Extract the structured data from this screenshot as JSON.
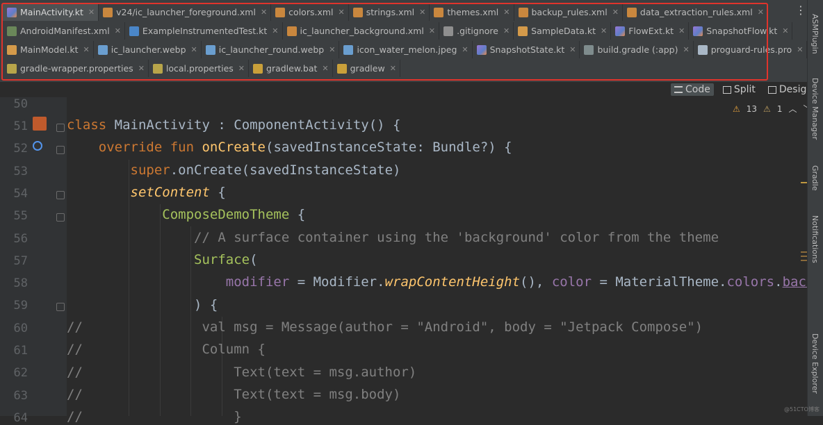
{
  "tabs": {
    "row1": [
      {
        "label": "MainActivity.kt",
        "icon": "kotlin-file-icon",
        "active": true
      },
      {
        "label": "v24/ic_launcher_foreground.xml",
        "icon": "xml-file-icon"
      },
      {
        "label": "colors.xml",
        "icon": "xml-file-icon"
      },
      {
        "label": "strings.xml",
        "icon": "xml-file-icon"
      },
      {
        "label": "themes.xml",
        "icon": "xml-file-icon"
      },
      {
        "label": "backup_rules.xml",
        "icon": "xml-file-icon"
      },
      {
        "label": "data_extraction_rules.xml",
        "icon": "xml-file-icon"
      }
    ],
    "row2": [
      {
        "label": "AndroidManifest.xml",
        "icon": "manifest-file-icon"
      },
      {
        "label": "ExampleInstrumentedTest.kt",
        "icon": "test-file-icon"
      },
      {
        "label": "ic_launcher_background.xml",
        "icon": "xml-file-icon"
      },
      {
        "label": ".gitignore",
        "icon": "gitignore-file-icon"
      },
      {
        "label": "SampleData.kt",
        "icon": "kotlin-class-icon"
      },
      {
        "label": "FlowExt.kt",
        "icon": "kotlin-file-icon"
      },
      {
        "label": "SnapshotFlow.kt",
        "icon": "kotlin-file-icon"
      }
    ],
    "row3": [
      {
        "label": "MainModel.kt",
        "icon": "kotlin-class-icon"
      },
      {
        "label": "ic_launcher.webp",
        "icon": "image-file-icon"
      },
      {
        "label": "ic_launcher_round.webp",
        "icon": "image-file-icon"
      },
      {
        "label": "icon_water_melon.jpeg",
        "icon": "image-file-icon"
      },
      {
        "label": "SnapshotState.kt",
        "icon": "kotlin-file-icon"
      },
      {
        "label": "build.gradle (:app)",
        "icon": "gradle-file-icon"
      },
      {
        "label": "proguard-rules.pro",
        "icon": "text-file-icon"
      }
    ],
    "row4": [
      {
        "label": "gradle-wrapper.properties",
        "icon": "properties-file-icon"
      },
      {
        "label": "local.properties",
        "icon": "properties-file-icon"
      },
      {
        "label": "gradlew.bat",
        "icon": "script-file-icon"
      },
      {
        "label": "gradlew",
        "icon": "script-file-icon"
      }
    ]
  },
  "modes": {
    "code": "Code",
    "split": "Split",
    "design": "Design"
  },
  "inspections": {
    "warnings": "13",
    "weak_warnings": "1"
  },
  "right_panel": {
    "asm": "ASMPlugin",
    "device_manager": "Device Manager",
    "gradle": "Gradle",
    "notifications": "Notifications",
    "device_explorer": "Device Explorer"
  },
  "line_numbers": [
    "50",
    "51",
    "52",
    "53",
    "54",
    "55",
    "56",
    "57",
    "58",
    "59",
    "60",
    "61",
    "62",
    "63",
    "64"
  ],
  "code": {
    "l51": {
      "kw": "class ",
      "name": "MainActivity",
      "rest1": " : ",
      "sup": "ComponentActivity",
      "rest2": "() {"
    },
    "l52": {
      "kw": "override fun ",
      "fn": "onCreate",
      "rest": "(savedInstanceState: Bundle?) {"
    },
    "l53": {
      "kw": "super",
      "rest": ".onCreate(savedInstanceState)"
    },
    "l54": {
      "it": "setContent",
      "rest": " {"
    },
    "l55": {
      "cmp": "ComposeDemoTheme",
      "rest": " {"
    },
    "l56": {
      "cm": "// A surface container using the 'background' color from the theme"
    },
    "l57": {
      "cmp": "Surface",
      "rest": "("
    },
    "l58": {
      "pm1": "modifier",
      "eq": " = Modifier.",
      "it": "wrapContentHeight",
      "rest": "(), ",
      "pm2": "color",
      "eq2": " = MaterialTheme.",
      "pm3": "colors",
      "dot": ".",
      "trunc": "backgro"
    },
    "l59": {
      "rest": ") {"
    },
    "l60": {
      "cm": "//               val msg = Message(author = \"Android\", body = \"Jetpack Compose\")"
    },
    "l61": {
      "cm": "//               Column {"
    },
    "l62": {
      "cm": "//                   Text(text = msg.author)"
    },
    "l63": {
      "cm": "//                   Text(text = msg.body)"
    },
    "l64": {
      "cm": "//                   }"
    }
  },
  "watermark": "@51CTO博客"
}
